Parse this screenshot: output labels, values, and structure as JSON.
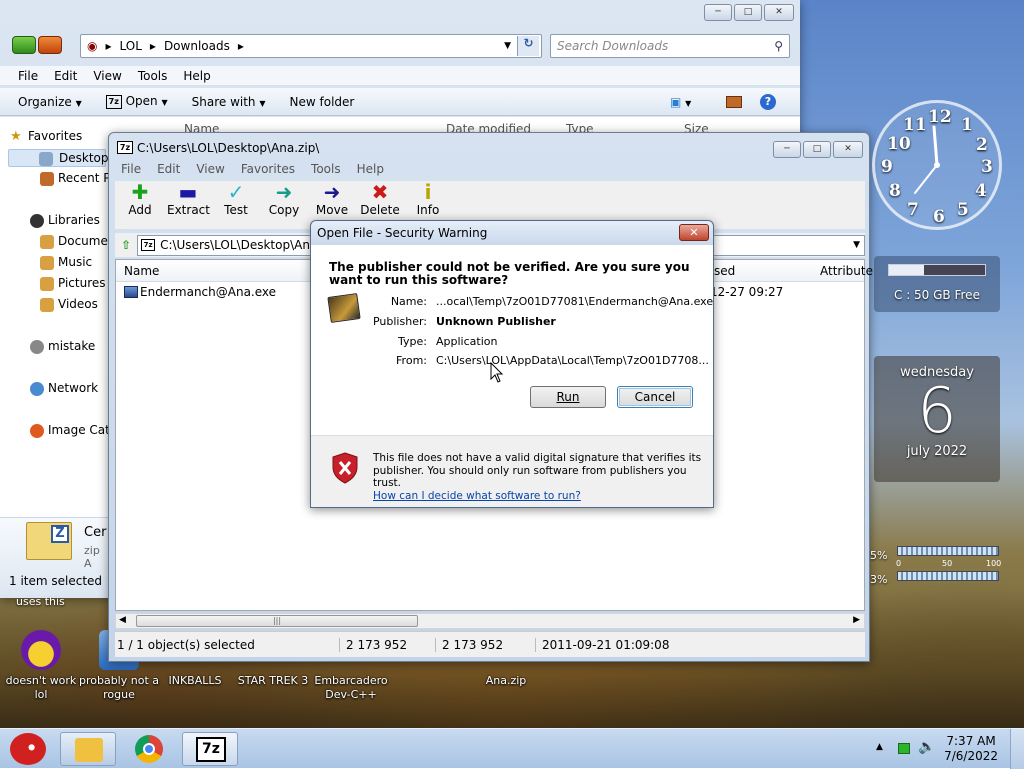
{
  "desktop": {
    "icons": [
      {
        "label": "doesn't work lol"
      },
      {
        "label": "probably not a rogue"
      },
      {
        "label": "INKBALLS"
      },
      {
        "label": "STAR TREK 3"
      },
      {
        "label": "Embarcadero Dev-C++"
      },
      {
        "label": "Ana.zip"
      }
    ],
    "partial_text": "uses this"
  },
  "explorer": {
    "breadcrumb": [
      "LOL",
      "Downloads"
    ],
    "search_placeholder": "Search Downloads",
    "menu": [
      "File",
      "Edit",
      "View",
      "Tools",
      "Help"
    ],
    "commands": {
      "organize": "Organize",
      "open": "Open",
      "share": "Share with",
      "new_folder": "New folder"
    },
    "columns": {
      "name": "Name",
      "date": "Date modified",
      "type": "Type",
      "size": "Size"
    },
    "nav": {
      "favorites": "Favorites",
      "desktop": "Desktop",
      "recent": "Recent P",
      "libraries": "Libraries",
      "documents": "Documen",
      "music": "Music",
      "pictures": "Pictures",
      "videos": "Videos",
      "homegroup": "mistake",
      "network": "Network",
      "image_catalog": "Image Cata"
    },
    "footer": {
      "file_name": "Cer",
      "file_type": "zip A",
      "status": "1 item selected"
    }
  },
  "sevenzip": {
    "title": "C:\\Users\\LOL\\Desktop\\Ana.zip\\",
    "menu": [
      "File",
      "Edit",
      "View",
      "Favorites",
      "Tools",
      "Help"
    ],
    "toolbar": [
      {
        "label": "Add",
        "icon": "plus-icon",
        "color": "#1aa31a"
      },
      {
        "label": "Extract",
        "icon": "minus-icon",
        "color": "#1a1aa8"
      },
      {
        "label": "Test",
        "icon": "check-icon",
        "color": "#2bb5c9"
      },
      {
        "label": "Copy",
        "icon": "copy-arrow-icon",
        "color": "#1a9a8a"
      },
      {
        "label": "Move",
        "icon": "move-arrow-icon",
        "color": "#1a1a8a"
      },
      {
        "label": "Delete",
        "icon": "delete-x-icon",
        "color": "#cc1a1a"
      },
      {
        "label": "Info",
        "icon": "info-icon",
        "color": "#b8a600"
      }
    ],
    "path": "C:\\Users\\LOL\\Desktop\\An",
    "columns": {
      "name": "Name",
      "accessed": "sed",
      "attributes": "Attribute"
    },
    "rows": [
      {
        "name": "Endermanch@Ana.exe",
        "accessed": "12-27 09:27"
      }
    ],
    "status": {
      "selected": "1 / 1 object(s) selected",
      "size": "2 173 952",
      "packed": "2 173 952",
      "date": "2011-09-21 01:09:08"
    }
  },
  "dialog": {
    "title": "Open File - Security Warning",
    "question": "The publisher could not be verified.  Are you sure you want to run this software?",
    "fields": [
      {
        "key": "Name:",
        "value": "...ocal\\Temp\\7zO01D77081\\Endermanch@Ana.exe",
        "bold": false
      },
      {
        "key": "Publisher:",
        "value": "Unknown Publisher",
        "bold": true
      },
      {
        "key": "Type:",
        "value": "Application",
        "bold": false
      },
      {
        "key": "From:",
        "value": "C:\\Users\\LOL\\AppData\\Local\\Temp\\7zO01D7708...",
        "bold": false
      }
    ],
    "run_label": "Run",
    "cancel_label": "Cancel",
    "footer_text": "This file does not have a valid digital signature that verifies its publisher.  You should only run software from publishers you trust.",
    "footer_link": "How can I decide what software to run?"
  },
  "gadgets": {
    "clock_numbers": [
      "12",
      "1",
      "2",
      "3",
      "4",
      "5",
      "6",
      "7",
      "8",
      "9",
      "10",
      "11"
    ],
    "drive": "C : 50 GB Free",
    "calendar": {
      "weekday": "wednesday",
      "day": "6",
      "month": "july 2022"
    },
    "cpu": {
      "cpu_pct": "5%",
      "ram_pct": "3%",
      "scale_0": "0",
      "scale_50": "50",
      "scale_100": "100",
      "cpu_value": 0.05,
      "ram_value": 0.03
    }
  },
  "taskbar": {
    "time": "7:37 AM",
    "date": "7/6/2022"
  }
}
